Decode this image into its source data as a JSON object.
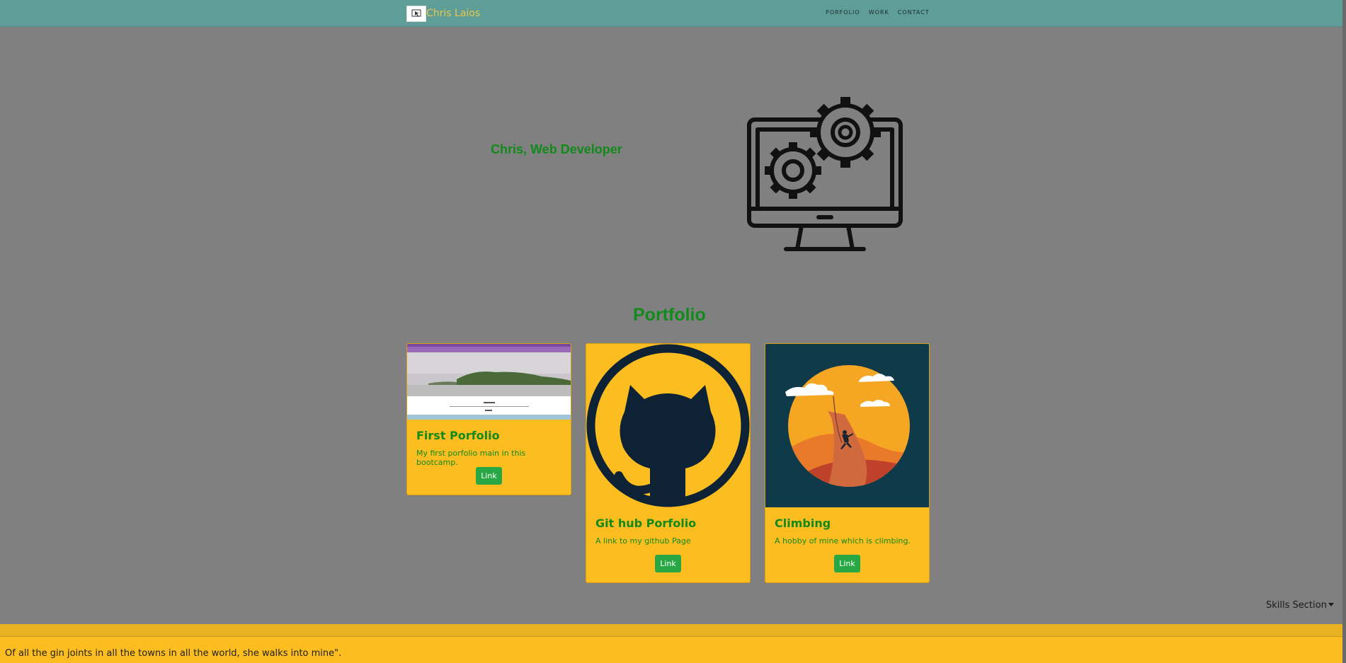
{
  "navbar": {
    "brand_name": "Chris Laios",
    "links": [
      "PORFOLIO",
      "WORK",
      "CONTACT"
    ]
  },
  "hero": {
    "title": "Chris, Web Developer"
  },
  "portfolio": {
    "heading": "Portfolio",
    "cards": [
      {
        "title": "First Porfolio",
        "text": "My first porfolio main in this bootcamp.",
        "button": "Link"
      },
      {
        "title": "Git hub Porfolio",
        "text": "A link to my github Page",
        "button": "Link"
      },
      {
        "title": "Climbing",
        "text": "A hobby of mine which is climbing.",
        "button": "Link"
      }
    ]
  },
  "skills": {
    "toggle_label": "Skills Section"
  },
  "footer": {
    "quote": "Of all the gin joints in all the towns in all the world, she walks into mine\"."
  },
  "colors": {
    "navbar": "#5f9e98",
    "background": "#808080",
    "accent_green": "#118a1a",
    "card_yellow": "#fbbd20",
    "button_green": "#28a745",
    "brand_gold": "#e8c84a"
  }
}
